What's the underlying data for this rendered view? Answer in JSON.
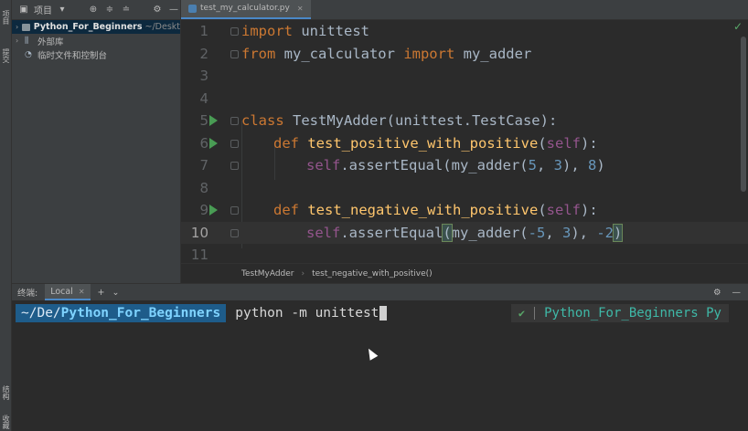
{
  "left_strip": {
    "project_tab": "项目",
    "bookmarks_tab": "提交",
    "structure_tab": "结构",
    "bottom_tab": "收藏"
  },
  "project_panel": {
    "title": "项目",
    "tree": [
      {
        "name": "Python_For_Beginners",
        "path": "~/Deskt"
      },
      {
        "name": "外部库"
      },
      {
        "name": "临时文件和控制台"
      }
    ]
  },
  "editor": {
    "tab_label": "test_my_calculator.py",
    "lines": [
      {
        "n": "1"
      },
      {
        "n": "2"
      },
      {
        "n": "3"
      },
      {
        "n": "4"
      },
      {
        "n": "5"
      },
      {
        "n": "6"
      },
      {
        "n": "7"
      },
      {
        "n": "8"
      },
      {
        "n": "9"
      },
      {
        "n": "10"
      },
      {
        "n": "11"
      }
    ],
    "code": {
      "l1_kw": "import",
      "l1_rest": " unittest",
      "l2_kw1": "from",
      "l2_mid": " my_calculator ",
      "l2_kw2": "import",
      "l2_rest": " my_adder",
      "l5_kw": "class",
      "l5_rest": " TestMyAdder(unittest.TestCase):",
      "l6_kw": "def",
      "l6_fn": "test_positive_with_positive",
      "l6_self": "self",
      "l6_tail": "):",
      "l7_self": "self",
      "l7_mid": ".assertEqual(my_adder(",
      "l7_n1": "5",
      "l7_c1": ", ",
      "l7_n2": "3",
      "l7_c2": "), ",
      "l7_n3": "8",
      "l7_end": ")",
      "l9_kw": "def",
      "l9_fn": "test_negative_with_positive",
      "l9_self": "self",
      "l9_tail": "):",
      "l10_self": "self",
      "l10_mid": ".assertEqual",
      "l10_open": "(",
      "l10_call": "my_adder(",
      "l10_n1": "-5",
      "l10_c1": ", ",
      "l10_n2": "3",
      "l10_c2": "), ",
      "l10_n3": "-2",
      "l10_close": ")"
    },
    "breadcrumb": [
      "TestMyAdder",
      "test_negative_with_positive()"
    ]
  },
  "terminal": {
    "title": "终端:",
    "tab": "Local",
    "prompt_prefix": "~/De/",
    "prompt_dir": "Python_For_Beginners",
    "command": "python -m unittest",
    "status_check": "✔",
    "venv": "Python_For_Beginners Py"
  },
  "colors": {
    "accent": "#4a88c7",
    "run": "#499c54",
    "keyword": "#cc7832",
    "function": "#ffc66d",
    "number": "#6897bb"
  }
}
